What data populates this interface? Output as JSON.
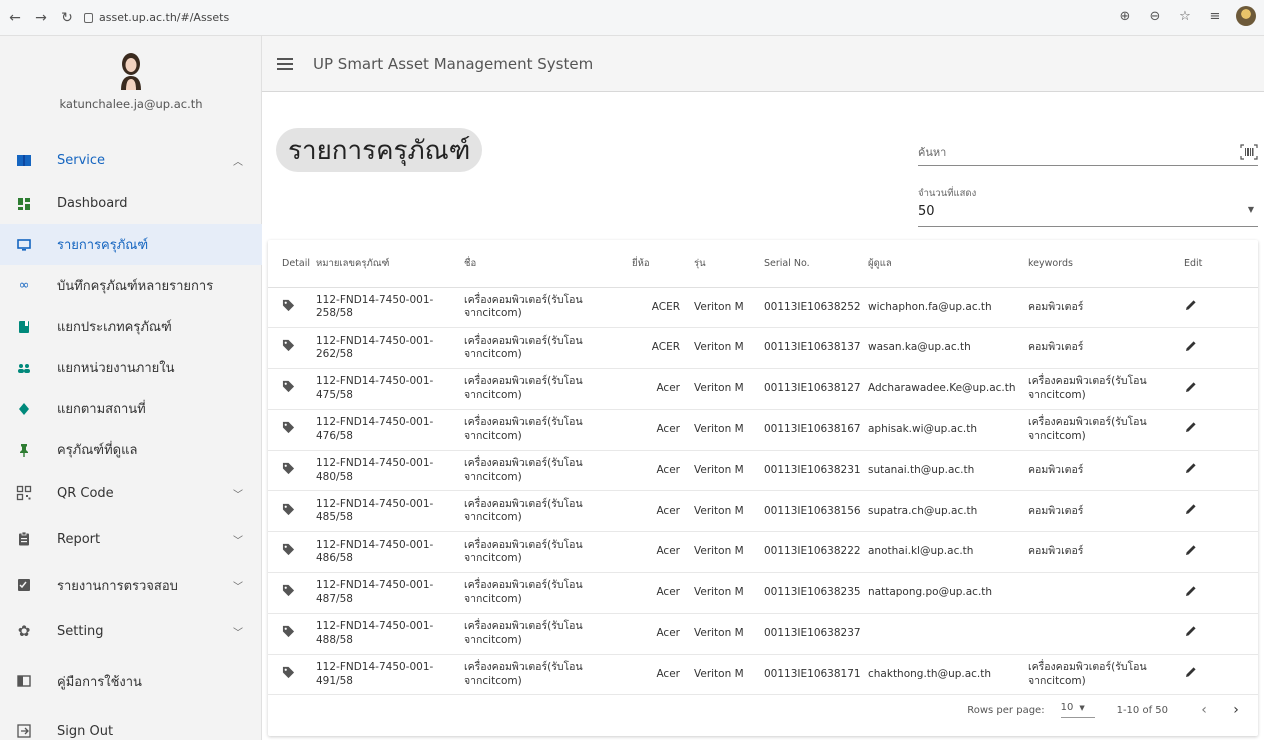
{
  "browser": {
    "url": "asset.up.ac.th/#/Assets"
  },
  "sidebar": {
    "email": "katunchalee.ja@up.ac.th",
    "items": [
      {
        "label": "Service",
        "icon": "book-icon",
        "chevron": "up"
      },
      {
        "label": "Dashboard",
        "icon": "dashboard-icon"
      },
      {
        "label": "รายการครุภัณฑ์",
        "icon": "monitor-icon",
        "active": true
      },
      {
        "label": "บันทึกครุภัณฑ์หลายรายการ",
        "icon": "infinity-icon"
      },
      {
        "label": "แยกประเภทครุภัณฑ์",
        "icon": "folder-icon"
      },
      {
        "label": "แยกหน่วยงานภายใน",
        "icon": "people-icon"
      },
      {
        "label": "แยกตามสถานที่",
        "icon": "place-icon"
      },
      {
        "label": "ครุภัณฑ์ที่ดูแล",
        "icon": "pin-icon"
      },
      {
        "label": "QR Code",
        "icon": "qr-icon",
        "chevron": "down"
      },
      {
        "label": "Report",
        "icon": "clipboard-icon",
        "chevron": "down"
      },
      {
        "label": "รายงานการตรวจสอบ",
        "icon": "checklist-icon",
        "chevron": "down"
      },
      {
        "label": "Setting",
        "icon": "gear-icon",
        "chevron": "down"
      },
      {
        "label": "คู่มือการใช้งาน",
        "icon": "manual-icon"
      },
      {
        "label": "Sign Out",
        "icon": "sign-out-icon"
      }
    ]
  },
  "appbar": {
    "title": "UP Smart Asset Management System"
  },
  "main": {
    "page_title": "รายการครุภัณฑ์",
    "search_placeholder": "ค้นหา",
    "display_count_label": "จำนวนที่แสดง",
    "display_count_value": "50"
  },
  "table": {
    "headers": [
      "Detail",
      "หมายเลขครุภัณฑ์",
      "ชื่อ",
      "ยี่ห้อ",
      "รุ่น",
      "Serial No.",
      "ผู้ดูแล",
      "keywords",
      "Edit"
    ],
    "rows": [
      {
        "num": "112-FND14-7450-001-258/58",
        "name": "เครื่องคอมพิวเตอร์(รับโอนจากcitcom)",
        "brand": "ACER",
        "model": "Veriton M",
        "serial": "00113IE10638252",
        "owner": "wichaphon.fa@up.ac.th",
        "kw": "คอมพิวเตอร์"
      },
      {
        "num": "112-FND14-7450-001-262/58",
        "name": "เครื่องคอมพิวเตอร์(รับโอนจากcitcom)",
        "brand": "ACER",
        "model": "Veriton M",
        "serial": "00113IE10638137",
        "owner": "wasan.ka@up.ac.th",
        "kw": "คอมพิวเตอร์"
      },
      {
        "num": "112-FND14-7450-001-475/58",
        "name": "เครื่องคอมพิวเตอร์(รับโอนจากcitcom)",
        "brand": "Acer",
        "model": "Veriton M",
        "serial": "00113IE10638127",
        "owner": "Adcharawadee.Ke@up.ac.th",
        "kw": "เครื่องคอมพิวเตอร์(รับโอนจากcitcom)"
      },
      {
        "num": "112-FND14-7450-001-476/58",
        "name": "เครื่องคอมพิวเตอร์(รับโอนจากcitcom)",
        "brand": "Acer",
        "model": "Veriton M",
        "serial": "00113IE10638167",
        "owner": "aphisak.wi@up.ac.th",
        "kw": "เครื่องคอมพิวเตอร์(รับโอนจากcitcom)"
      },
      {
        "num": "112-FND14-7450-001-480/58",
        "name": "เครื่องคอมพิวเตอร์(รับโอนจากcitcom)",
        "brand": "Acer",
        "model": "Veriton M",
        "serial": "00113IE10638231",
        "owner": "sutanai.th@up.ac.th",
        "kw": "คอมพิวเตอร์"
      },
      {
        "num": "112-FND14-7450-001-485/58",
        "name": "เครื่องคอมพิวเตอร์(รับโอนจากcitcom)",
        "brand": "Acer",
        "model": "Veriton M",
        "serial": "00113IE10638156",
        "owner": "supatra.ch@up.ac.th",
        "kw": "คอมพิวเตอร์"
      },
      {
        "num": "112-FND14-7450-001-486/58",
        "name": "เครื่องคอมพิวเตอร์(รับโอนจากcitcom)",
        "brand": "Acer",
        "model": "Veriton M",
        "serial": "00113IE10638222",
        "owner": "anothai.kl@up.ac.th",
        "kw": "คอมพิวเตอร์"
      },
      {
        "num": "112-FND14-7450-001-487/58",
        "name": "เครื่องคอมพิวเตอร์(รับโอนจากcitcom)",
        "brand": "Acer",
        "model": "Veriton M",
        "serial": "00113IE10638235",
        "owner": "nattapong.po@up.ac.th",
        "kw": ""
      },
      {
        "num": "112-FND14-7450-001-488/58",
        "name": "เครื่องคอมพิวเตอร์(รับโอนจากcitcom)",
        "brand": "Acer",
        "model": "Veriton M",
        "serial": "00113IE10638237",
        "owner": "",
        "kw": ""
      },
      {
        "num": "112-FND14-7450-001-491/58",
        "name": "เครื่องคอมพิวเตอร์(รับโอนจากcitcom)",
        "brand": "Acer",
        "model": "Veriton M",
        "serial": "00113IE10638171",
        "owner": "chakthong.th@up.ac.th",
        "kw": "เครื่องคอมพิวเตอร์(รับโอนจากcitcom)"
      }
    ]
  },
  "pagination": {
    "rows_per_page_label": "Rows per page:",
    "rows_per_page": "10",
    "range": "1-10 of 50"
  },
  "colors": {
    "accent": "#1565c0",
    "sidebar_bg": "#f3f3f3",
    "icon_dark": "#555555"
  }
}
